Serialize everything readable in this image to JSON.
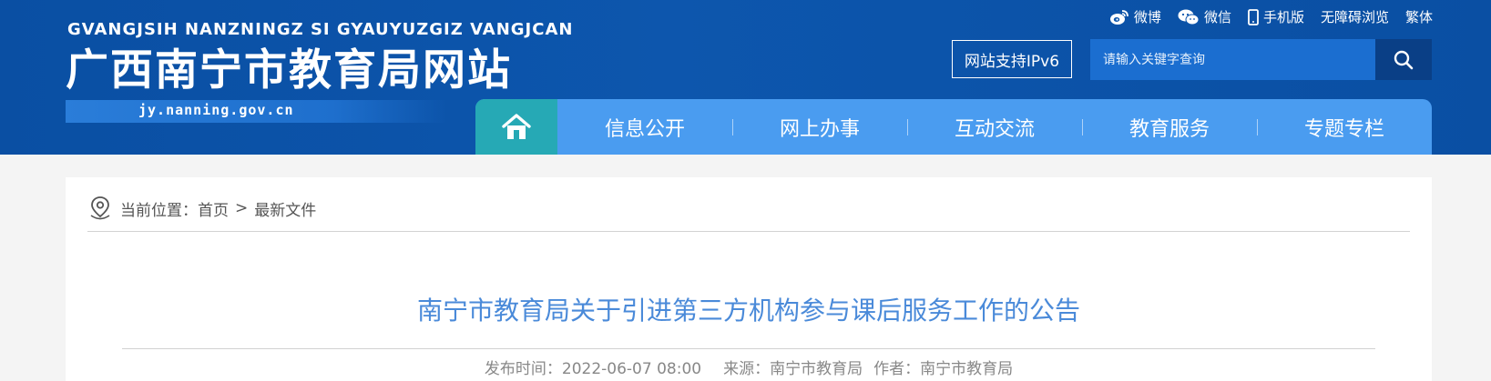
{
  "header": {
    "logo": {
      "pinyin": "GVANGJSIH NANZNINGZ SI GYAUYUZGIZ VANGJCAN",
      "title": "广西南宁市教育局网站",
      "domain": "jy.nanning.gov.cn"
    },
    "top_links": [
      {
        "label": "微博",
        "icon": "weibo-icon"
      },
      {
        "label": "微信",
        "icon": "wechat-icon"
      },
      {
        "label": "手机版",
        "icon": "mobile-icon"
      },
      {
        "label": "无障碍浏览"
      },
      {
        "label": "繁体"
      }
    ],
    "ipv6_label": "网站支持IPv6",
    "search": {
      "placeholder": "请输入关键字查询",
      "button_icon": "search-icon"
    },
    "colors": {
      "header_bg": "#0a4fa3",
      "nav_bg": "#4a9cf0",
      "nav_home_bg": "#26a9b5",
      "search_btn_bg": "#0a3f86"
    }
  },
  "nav": {
    "home_icon": "home-icon",
    "items": [
      {
        "label": "信息公开"
      },
      {
        "label": "网上办事"
      },
      {
        "label": "互动交流"
      },
      {
        "label": "教育服务"
      },
      {
        "label": "专题专栏"
      }
    ]
  },
  "breadcrumb": {
    "icon": "location-pin-icon",
    "prefix": "当前位置：",
    "items": [
      {
        "label": "首页"
      },
      {
        "label": "最新文件"
      }
    ],
    "separator": ">"
  },
  "article": {
    "title": "南宁市教育局关于引进第三方机构参与课后服务工作的公告",
    "publish_label": "发布时间：",
    "publish_time": "2022-06-07 08:00",
    "source_label": "来源：",
    "source": "南宁市教育局",
    "author_label": "作者：",
    "author": "南宁市教育局",
    "title_color": "#4a8ad9"
  }
}
